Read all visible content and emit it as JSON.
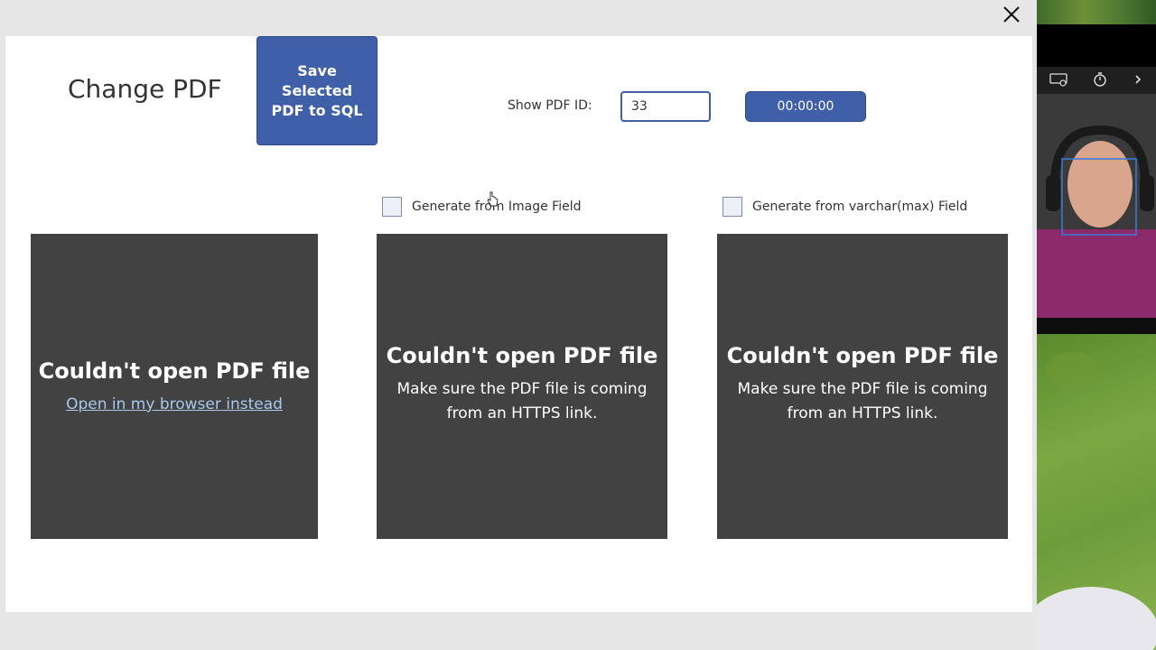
{
  "window": {
    "close_icon": "close-icon"
  },
  "header": {
    "title": "Change PDF",
    "save_button_label": "Save Selected PDF to SQL",
    "pdf_id_label": "Show PDF ID:",
    "pdf_id_value": "33",
    "timer_label": "00:00:00"
  },
  "checkboxes": [
    {
      "label": "Generate from Image Field",
      "checked": false
    },
    {
      "label": "Generate from varchar(max) Field",
      "checked": false
    }
  ],
  "viewers": [
    {
      "heading": "Couldn't open PDF file",
      "link": "Open in my browser instead"
    },
    {
      "heading": "Couldn't open PDF file",
      "message": "Make sure the PDF file is coming from an HTTPS link."
    },
    {
      "heading": "Couldn't open PDF file",
      "message": "Make sure the PDF file is coming from an HTTPS link."
    }
  ],
  "webcam": {
    "toolbar_icons": [
      "hdr-icon",
      "timer-icon",
      "chevron-right-icon"
    ]
  },
  "colors": {
    "accent": "#3f5fa8",
    "viewer_bg": "#424242",
    "link": "#a8c8ec",
    "frame": "#e6e6e6"
  }
}
